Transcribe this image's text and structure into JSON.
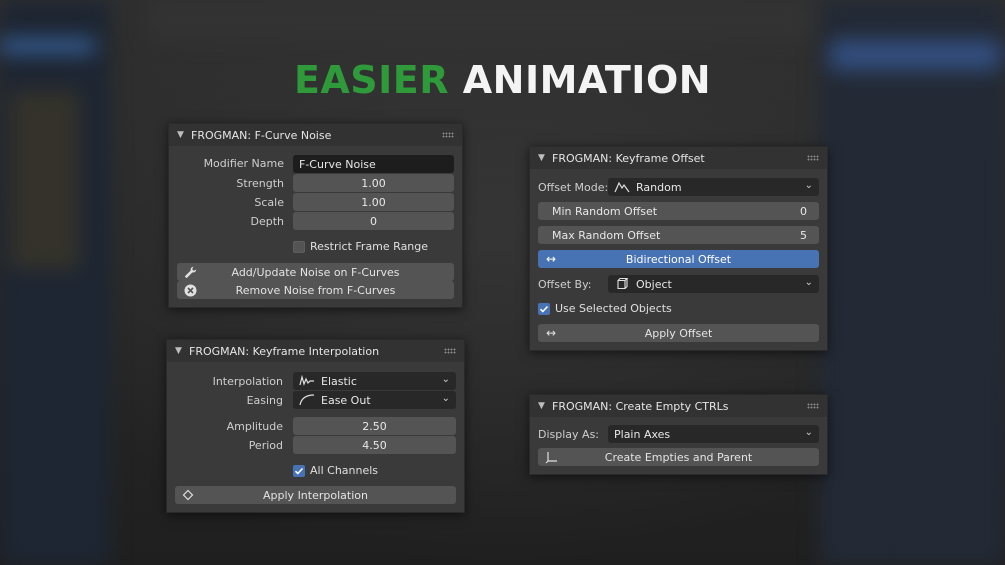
{
  "headline": {
    "accent": "EASIER",
    "main": "ANIMATION"
  },
  "noise_panel": {
    "title": "FROGMAN: F-Curve Noise",
    "modifier_label": "Modifier Name",
    "modifier_value": "F-Curve Noise",
    "strength_label": "Strength",
    "strength_value": "1.00",
    "scale_label": "Scale",
    "scale_value": "1.00",
    "depth_label": "Depth",
    "depth_value": "0",
    "restrict_label": "Restrict Frame Range",
    "restrict_checked": false,
    "add_button": "Add/Update Noise on F-Curves",
    "remove_button": "Remove Noise from F-Curves"
  },
  "interp_panel": {
    "title": "FROGMAN: Keyframe Interpolation",
    "interpolation_label": "Interpolation",
    "interpolation_value": "Elastic",
    "easing_label": "Easing",
    "easing_value": "Ease Out",
    "amplitude_label": "Amplitude",
    "amplitude_value": "2.50",
    "period_label": "Period",
    "period_value": "4.50",
    "all_channels_label": "All Channels",
    "all_channels_checked": true,
    "apply_button": "Apply Interpolation"
  },
  "offset_panel": {
    "title": "FROGMAN: Keyframe Offset",
    "mode_label": "Offset Mode:",
    "mode_value": "Random",
    "min_label": "Min Random Offset",
    "min_value": "0",
    "max_label": "Max Random Offset",
    "max_value": "5",
    "bidirectional_button": "Bidirectional Offset",
    "offset_by_label": "Offset By:",
    "offset_by_value": "Object",
    "use_selected_label": "Use Selected Objects",
    "use_selected_checked": true,
    "apply_button": "Apply Offset"
  },
  "ctrl_panel": {
    "title": "FROGMAN: Create Empty CTRLs",
    "display_label": "Display As:",
    "display_value": "Plain Axes",
    "create_button": "Create Empties and Parent"
  },
  "colors": {
    "accent_green": "#2e9a3a",
    "active_blue": "#4772b3",
    "panel_bg": "#3a3a3a"
  }
}
